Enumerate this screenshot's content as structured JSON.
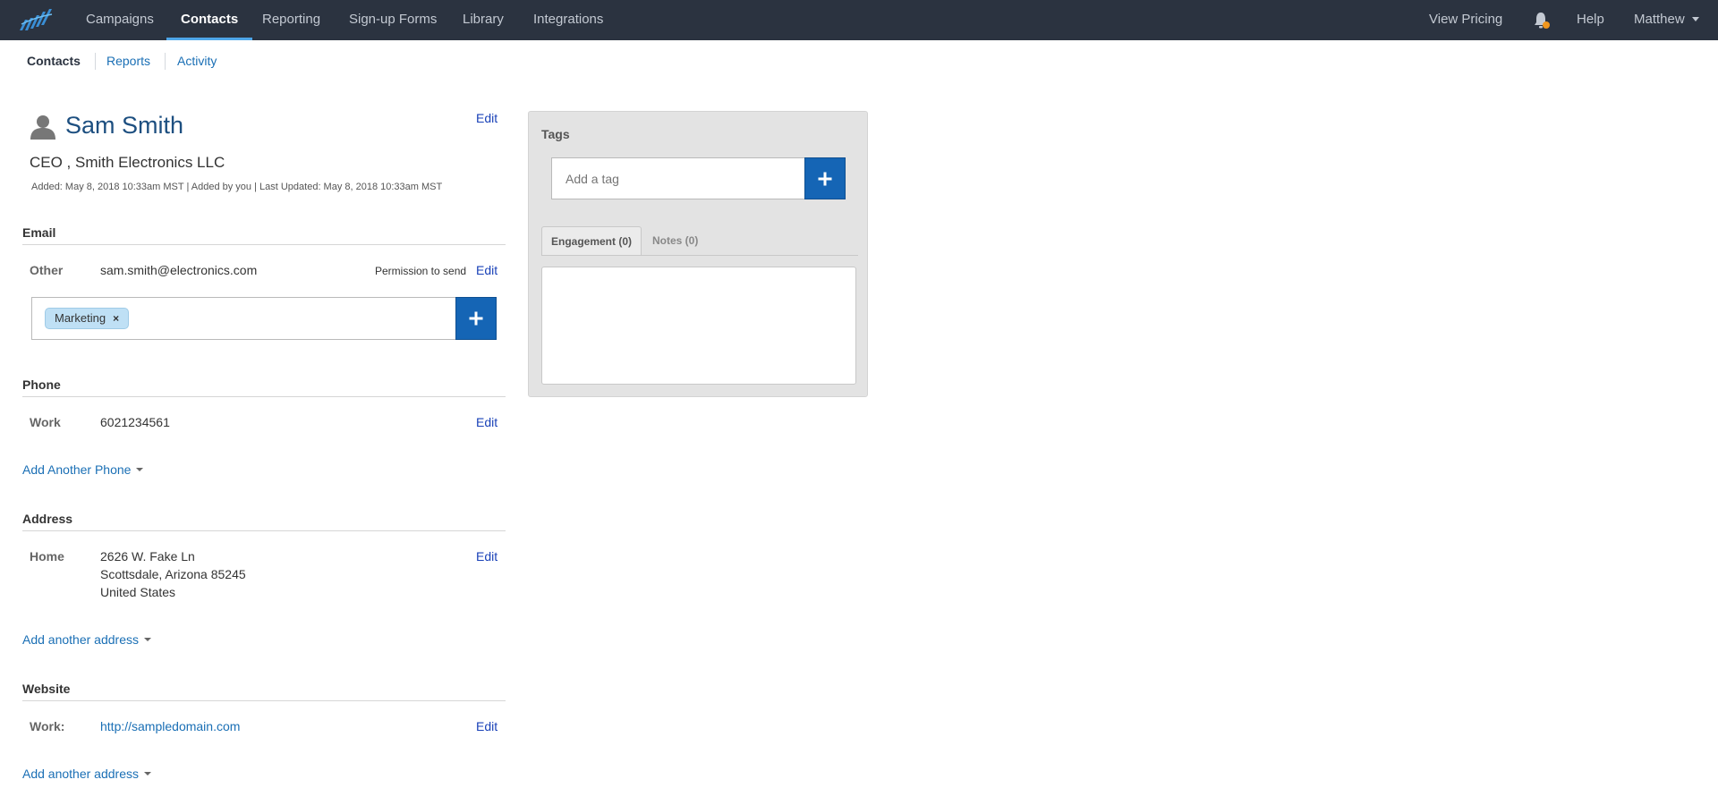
{
  "topnav": {
    "items": [
      {
        "label": "Campaigns",
        "active": false
      },
      {
        "label": "Contacts",
        "active": true
      },
      {
        "label": "Reporting",
        "active": false
      },
      {
        "label": "Sign-up Forms",
        "active": false
      },
      {
        "label": "Library",
        "active": false
      },
      {
        "label": "Integrations",
        "active": false
      }
    ],
    "view_pricing": "View Pricing",
    "help": "Help",
    "user": "Matthew",
    "accent_color": "#4ea6e8",
    "notification_color": "#f0961e"
  },
  "subnav": {
    "items": [
      {
        "label": "Contacts",
        "active": true
      },
      {
        "label": "Reports",
        "active": false
      },
      {
        "label": "Activity",
        "active": false
      }
    ]
  },
  "contact": {
    "name": "Sam Smith",
    "title_company": "CEO , Smith Electronics LLC",
    "meta": "Added: May 8, 2018 10:33am MST | Added by you | Last Updated: May 8, 2018 10:33am MST",
    "edit_label": "Edit"
  },
  "email": {
    "section_title": "Email",
    "type": "Other",
    "address": "sam.smith@electronics.com",
    "permission": "Permission to send",
    "edit_label": "Edit",
    "lists": [
      {
        "label": "Marketing",
        "remove": "×"
      }
    ]
  },
  "phone": {
    "section_title": "Phone",
    "type": "Work",
    "number": "6021234561",
    "edit_label": "Edit",
    "add_label": "Add Another Phone"
  },
  "address": {
    "section_title": "Address",
    "type": "Home",
    "line1": "2626 W. Fake Ln",
    "line2": "Scottsdale, Arizona 85245",
    "line3": "United States",
    "edit_label": "Edit",
    "add_label": "Add another address"
  },
  "website": {
    "section_title": "Website",
    "type": "Work:",
    "url": "http://sampledomain.com",
    "edit_label": "Edit",
    "add_label": "Add another address"
  },
  "tags_panel": {
    "title": "Tags",
    "input_placeholder": "Add a tag",
    "tabs": [
      {
        "label": "Engagement (0)",
        "active": true
      },
      {
        "label": "Notes (0)",
        "active": false
      }
    ]
  }
}
